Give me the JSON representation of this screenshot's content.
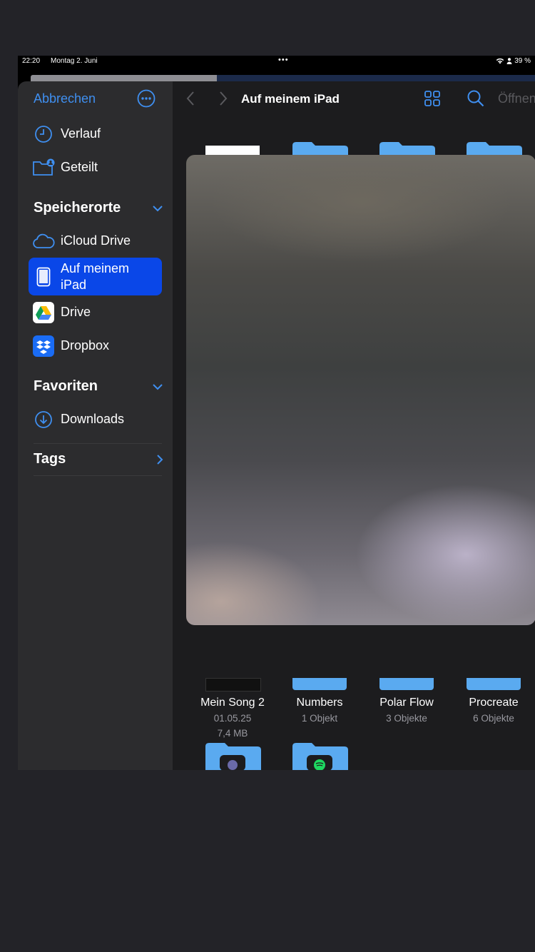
{
  "status_bar": {
    "time": "22:20",
    "date": "Montag 2. Juni",
    "battery": "39 %"
  },
  "sidebar": {
    "cancel_label": "Abbrechen",
    "top_items": [
      {
        "label": "Verlauf",
        "icon": "clock-icon"
      },
      {
        "label": "Geteilt",
        "icon": "shared-folder-icon"
      }
    ],
    "locations_header": "Speicherorte",
    "locations": [
      {
        "label": "iCloud Drive",
        "icon": "cloud-icon"
      },
      {
        "label": "Auf meinem iPad",
        "icon": "ipad-icon",
        "selected": true
      },
      {
        "label": "Drive",
        "icon": "google-drive-icon"
      },
      {
        "label": "Dropbox",
        "icon": "dropbox-icon"
      }
    ],
    "favorites_header": "Favoriten",
    "favorites": [
      {
        "label": "Downloads",
        "icon": "download-circle-icon"
      }
    ],
    "tags_header": "Tags"
  },
  "toolbar": {
    "title": "Auf meinem iPad",
    "open_label": "Öffnen"
  },
  "files": [
    {
      "name": "Mein Song 2",
      "line1": "01.05.25",
      "line2": "7,4 MB"
    },
    {
      "name": "Numbers",
      "line1": "1 Objekt"
    },
    {
      "name": "Polar Flow",
      "line1": "3 Objekte"
    },
    {
      "name": "Procreate",
      "line1": "6 Objekte"
    }
  ],
  "colors": {
    "accent": "#3f8ff0",
    "selected": "#0a47e8",
    "folder": "#5aaaf0"
  }
}
